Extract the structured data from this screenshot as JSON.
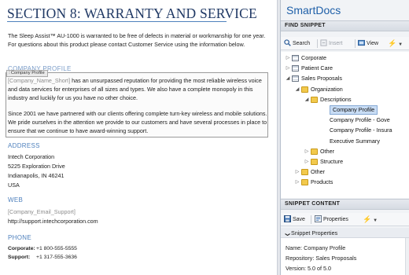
{
  "document": {
    "title": "SECTION 8: WARRANTY AND SERVICE",
    "intro": "The Sleep Assist™ AU-1000 is warranted to be free of defects in material or workmanship for one year. For questions about this product please contact Customer Service using the information below.",
    "company_profile_label": "COMPANY PROFILE",
    "snippet_tag": "Company Profile",
    "company_placeholder": "[Company_Name_Short]",
    "company_text": " has an unsurpassed reputation for providing the most reliable wireless voice and data services for enterprises of all sizes and types. We also have a complete monopoly in this industry and luckily for us you have no other choice.",
    "since_text": "Since 2001 we have partnered with our clients offering complete turn-key wireless and mobile solutions. We pride ourselves in the attention we provide to our customers and have several processes in place to ensure that we continue to have award-winning support.",
    "address_label": "ADDRESS",
    "address_lines": [
      "Intech Corporation",
      "5225 Exploration Drive",
      "Indianapolis, IN  46241",
      "USA"
    ],
    "web_label": "WEB",
    "web_placeholder": "[Company_Email_Support]",
    "web_url": "http://support.intechcorporation.com",
    "phone_label": "PHONE",
    "phones": [
      {
        "label": "Corporate:",
        "value": "+1 800-555-5555"
      },
      {
        "label": "Support:",
        "value": "+1 317-555-3636"
      }
    ]
  },
  "panel": {
    "title": "SmartDocs",
    "find_header": "FIND SNIPPET",
    "find_toolbar": {
      "search": "Search",
      "insert": "Insert",
      "view": "View"
    },
    "tree": [
      {
        "label": "Corporate",
        "type": "doc",
        "twisty": "+"
      },
      {
        "label": "Patient Care",
        "type": "doc",
        "twisty": "+"
      },
      {
        "label": "Sales Proposals",
        "type": "doc",
        "twisty": "−"
      },
      {
        "label": "Organization",
        "type": "folder",
        "twisty": "−"
      },
      {
        "label": "Descriptions",
        "type": "folder",
        "twisty": "−"
      },
      {
        "label": "Company Profile",
        "type": "snippet",
        "twisty": "",
        "selected": true
      },
      {
        "label": "Company Profile - Gove",
        "type": "snippet",
        "twisty": ""
      },
      {
        "label": "Company Profile - Insura",
        "type": "snippet",
        "twisty": ""
      },
      {
        "label": "Executive Summary",
        "type": "snippet",
        "twisty": ""
      },
      {
        "label": "Other",
        "type": "folder",
        "twisty": "+"
      },
      {
        "label": "Structure",
        "type": "folder",
        "twisty": "+"
      },
      {
        "label": "Other",
        "type": "folder",
        "twisty": "+"
      },
      {
        "label": "Products",
        "type": "folder",
        "twisty": "+"
      }
    ],
    "content_header": "SNIPPET CONTENT",
    "content_toolbar": {
      "save": "Save",
      "properties": "Properties"
    },
    "props_header": "Snippet Properties",
    "props_toggle": "❯",
    "properties": {
      "name": "Name: Company Profile",
      "repository": "Repository: Sales Proposals",
      "version": "Version: 5.0 of 5.0"
    }
  }
}
